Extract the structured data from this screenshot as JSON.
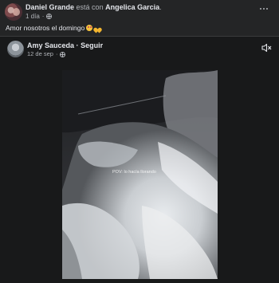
{
  "post": {
    "author": "Daniel Grande",
    "with_text": "está con",
    "tagged": "Angelica Garcia",
    "period": ".",
    "time": "1 día",
    "separator": "·",
    "text": "Amor nosotros el domingo",
    "privacy_icon": "globe-icon",
    "more_icon": "more-horizontal-icon"
  },
  "shared": {
    "author": "Amy Sauceda",
    "separator": "·",
    "follow_label": "Seguir",
    "date": "12 de sep",
    "date_separator": "·",
    "privacy_icon": "globe-icon",
    "mute_icon": "volume-muted-icon"
  },
  "video": {
    "overlay_text": "POV: lo hacía llorando"
  },
  "emojis": [
    "smiling-face-with-heart-eyes-icon",
    "yellow-heart-icon"
  ],
  "colors": {
    "background": "#242526",
    "shared_background": "#18191a",
    "text_primary": "#e4e6eb",
    "text_secondary": "#b0b3b8"
  }
}
